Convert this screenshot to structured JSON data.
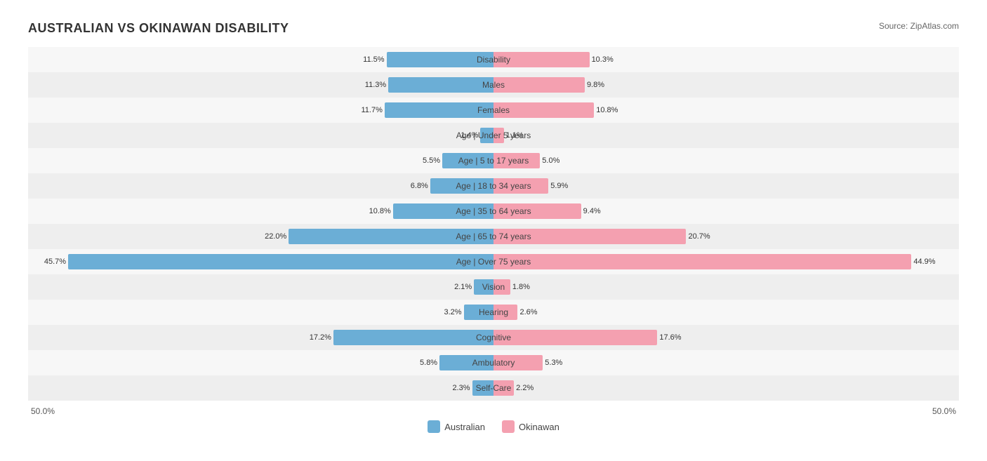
{
  "title": "AUSTRALIAN VS OKINAWAN DISABILITY",
  "source": "Source: ZipAtlas.com",
  "rows": [
    {
      "label": "Disability",
      "leftVal": "11.5%",
      "rightVal": "10.3%",
      "leftPct": 23.0,
      "rightPct": 20.6
    },
    {
      "label": "Males",
      "leftVal": "11.3%",
      "rightVal": "9.8%",
      "leftPct": 22.6,
      "rightPct": 19.6
    },
    {
      "label": "Females",
      "leftVal": "11.7%",
      "rightVal": "10.8%",
      "leftPct": 23.4,
      "rightPct": 21.6
    },
    {
      "label": "Age | Under 5 years",
      "leftVal": "1.4%",
      "rightVal": "1.1%",
      "leftPct": 2.8,
      "rightPct": 2.2
    },
    {
      "label": "Age | 5 to 17 years",
      "leftVal": "5.5%",
      "rightVal": "5.0%",
      "leftPct": 11.0,
      "rightPct": 10.0
    },
    {
      "label": "Age | 18 to 34 years",
      "leftVal": "6.8%",
      "rightVal": "5.9%",
      "leftPct": 13.6,
      "rightPct": 11.8
    },
    {
      "label": "Age | 35 to 64 years",
      "leftVal": "10.8%",
      "rightVal": "9.4%",
      "leftPct": 21.6,
      "rightPct": 18.8
    },
    {
      "label": "Age | 65 to 74 years",
      "leftVal": "22.0%",
      "rightVal": "20.7%",
      "leftPct": 44.0,
      "rightPct": 41.4
    },
    {
      "label": "Age | Over 75 years",
      "leftVal": "45.7%",
      "rightVal": "44.9%",
      "leftPct": 91.4,
      "rightPct": 89.8
    },
    {
      "label": "Vision",
      "leftVal": "2.1%",
      "rightVal": "1.8%",
      "leftPct": 4.2,
      "rightPct": 3.6
    },
    {
      "label": "Hearing",
      "leftVal": "3.2%",
      "rightVal": "2.6%",
      "leftPct": 6.4,
      "rightPct": 5.2
    },
    {
      "label": "Cognitive",
      "leftVal": "17.2%",
      "rightVal": "17.6%",
      "leftPct": 34.4,
      "rightPct": 35.2
    },
    {
      "label": "Ambulatory",
      "leftVal": "5.8%",
      "rightVal": "5.3%",
      "leftPct": 11.6,
      "rightPct": 10.6
    },
    {
      "label": "Self-Care",
      "leftVal": "2.3%",
      "rightVal": "2.2%",
      "leftPct": 4.6,
      "rightPct": 4.4
    }
  ],
  "footer": {
    "left": "50.0%",
    "right": "50.0%"
  },
  "legend": {
    "australian": "Australian",
    "okinawan": "Okinawan"
  },
  "colors": {
    "blue": "#6baed6",
    "pink": "#f4a0b0",
    "odd_bg": "#f7f7f7",
    "even_bg": "#eeeeee"
  }
}
